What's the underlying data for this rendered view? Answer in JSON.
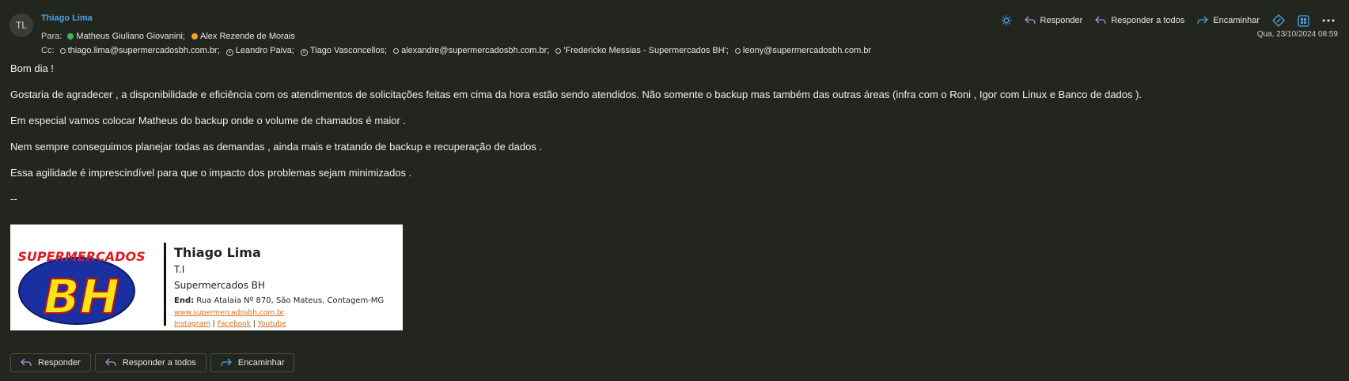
{
  "header": {
    "avatar_initials": "TL",
    "sender": "Thiago Lima",
    "to_label": "Para:",
    "to": [
      {
        "name": "Matheus Giuliano Giovanini;",
        "status": "available",
        "color": "#3fb950"
      },
      {
        "name": "Alex Rezende de Morais",
        "status": "away",
        "color": "#f0a020"
      }
    ],
    "cc_label": "Cc:",
    "cc": [
      {
        "name": "thiago.lima@supermercadosbh.com.br;",
        "status": "none"
      },
      {
        "name": "Leandro Paiva;",
        "status": "offline"
      },
      {
        "name": "Tiago Vasconcellos;",
        "status": "offline"
      },
      {
        "name": "alexandre@supermercadosbh.com.br;",
        "status": "none"
      },
      {
        "name": "'Fredericko Messias - Supermercados BH';",
        "status": "none"
      },
      {
        "name": "leony@supermercadosbh.com.br",
        "status": "none"
      }
    ],
    "date": "Qua, 23/10/2024 08:59"
  },
  "toolbar": {
    "reply": "Responder",
    "reply_all": "Responder a todos",
    "forward": "Encaminhar",
    "accent": "#4aa3e8",
    "reply_color": "#b48ade"
  },
  "body": {
    "greeting": "Bom dia  !",
    "p1": "Gostaria de agradecer , a disponibilidade e eficiência com os atendimentos de solicitações feitas  em cima da hora estão sendo atendidos.  Não somente o backup  mas também das outras áreas (infra com o Roni , Igor com Linux e   Banco de dados ).",
    "p2": "Em especial vamos colocar Matheus do backup onde o volume de chamados é maior .",
    "p3": "Nem sempre conseguimos planejar todas as demandas , ainda mais e tratando de backup e recuperação de dados .",
    "p4": "Essa agilidade é imprescindível para que o impacto dos problemas sejam minimizados .",
    "sig_sep": "--"
  },
  "signature": {
    "logo_top": "SUPERMERCADOS",
    "logo_main": "BH",
    "name": "Thiago Lima",
    "role": "T.I",
    "company": "Supermercados BH",
    "address_label": "End:",
    "address": "Rua Atalaia Nº 870, São Mateus, Contagem-MG",
    "website": "www.supermercadosbh.com.br",
    "links": [
      "Instagram",
      "Facebook",
      "Youtube"
    ],
    "sep": "|"
  },
  "actions": {
    "reply": "Responder",
    "reply_all": "Responder a todos",
    "forward": "Encaminhar"
  }
}
